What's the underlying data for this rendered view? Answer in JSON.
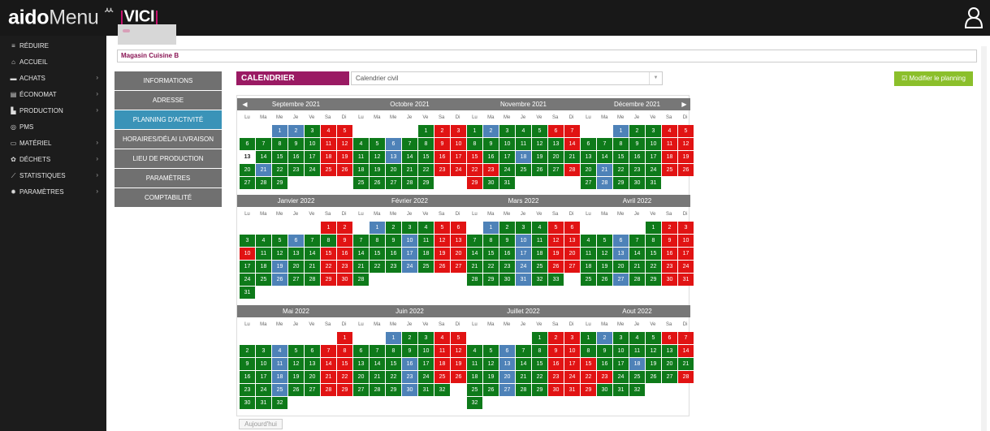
{
  "header": {
    "logo_bold": "aido",
    "logo_rest": "Menu",
    "logo_mark": "ᄊ",
    "partner": "VICI"
  },
  "sidebar": {
    "items": [
      {
        "label": "RÉDUIRE",
        "icon": "menu-icon",
        "chevron": false
      },
      {
        "label": "ACCUEIL",
        "icon": "home-icon",
        "chevron": false
      },
      {
        "label": "ACHATS",
        "icon": "cart-icon",
        "chevron": true
      },
      {
        "label": "ÉCONOMAT",
        "icon": "warehouse-icon",
        "chevron": true
      },
      {
        "label": "PRODUCTION",
        "icon": "factory-icon",
        "chevron": true
      },
      {
        "label": "PMS",
        "icon": "pms-icon",
        "chevron": false
      },
      {
        "label": "MATÉRIEL",
        "icon": "monitor-icon",
        "chevron": true
      },
      {
        "label": "DÉCHETS",
        "icon": "recycle-icon",
        "chevron": true
      },
      {
        "label": "STATISTIQUES",
        "icon": "chart-icon",
        "chevron": true
      },
      {
        "label": "PARAMÈTRES",
        "icon": "gear-icon",
        "chevron": true
      }
    ]
  },
  "store": {
    "name": "Magasin Cuisine B"
  },
  "menu": {
    "items": [
      "INFORMATIONS",
      "ADRESSE",
      "PLANNING D'ACTIVITÉ",
      "HORAIRES/DÉLAI LIVRAISON",
      "LIEU DE PRODUCTION",
      "PARAMÈTRES",
      "COMPTABILITÉ"
    ],
    "active_index": 2
  },
  "calendar": {
    "heading": "CALENDRIER",
    "select_value": "Calendrier civil",
    "edit_button": "Modifier le planning",
    "today_button": "Aujourd'hui",
    "weekdays": [
      "Lu",
      "Ma",
      "Me",
      "Je",
      "Ve",
      "Sa",
      "Di"
    ],
    "colors": {
      "open": "#0e7a1a",
      "closed": "#e11313",
      "holiday": "#4e82b8"
    },
    "months": [
      {
        "name": "Septembre 2021",
        "offset": 2,
        "days": "bbgrrgggggrrgggggrrgbgggrrggg"
      },
      {
        "name": "Octobre 2021",
        "offset": 4,
        "days": "grrggbggrrggbggrrgggggrrggggg"
      },
      {
        "name": "Novembre 2021",
        "offset": 0,
        "days": "gbgggrrggggggrrggbgggrrggggrrgg"
      },
      {
        "name": "Décembre 2021",
        "offset": 2,
        "days": "bggrrgggggrrgggggrrgbgggrrgbggg"
      },
      {
        "name": "Janvier 2022",
        "offset": 5,
        "days": "rrgggbggrrggggrrggbggrrggbggrrg"
      },
      {
        "name": "Février 2022",
        "offset": 1,
        "days": "bgggrrgggbgrrgggbgrrgggbgrrg"
      },
      {
        "name": "Mars 2022",
        "offset": 1,
        "days": "bgggrrgggbgrrgggbgrrgggbgrrgggbgg"
      },
      {
        "name": "Avril 2022",
        "offset": 4,
        "days": "grrggbggrrggbggrrgggggrrggbggrr"
      },
      {
        "name": "Mai 2022",
        "offset": 6,
        "days": "rggbggrrggbggrrggbggrrggbggrrggg"
      },
      {
        "name": "Juin 2022",
        "offset": 2,
        "days": "bggrrgggggrrgggbgrrgggbgrrgggbgg"
      },
      {
        "name": "Juillet 2022",
        "offset": 4,
        "days": "grrggbggrrggbggrrggbggrrggbggrrg"
      },
      {
        "name": "Aout 2022",
        "offset": 0,
        "days": "gbgggrrggggggrrggbgggrrggggrrggg"
      }
    ],
    "today": {
      "month": 0,
      "day": 13
    }
  }
}
